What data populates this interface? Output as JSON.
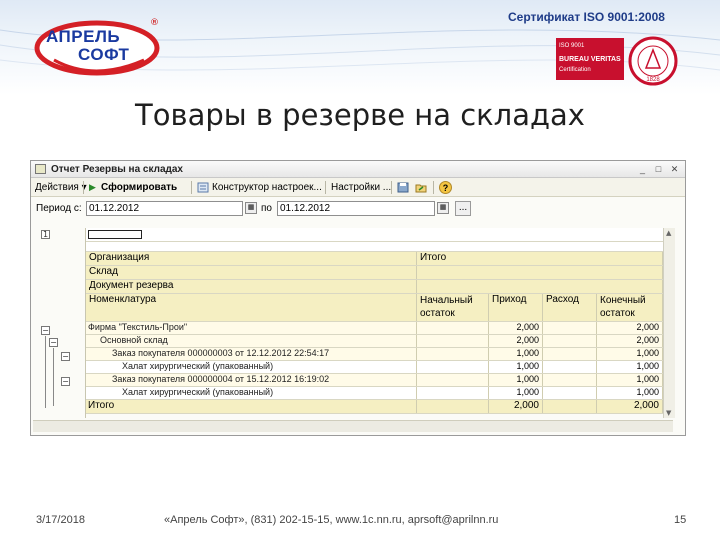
{
  "header": {
    "certificate": "Сертификат ISO 9001:2008",
    "logo_line1": "АПРЕЛЬ",
    "logo_line2": "СОФТ",
    "reg_mark": "®",
    "bv_iso": "ISO 9001",
    "bv_name": "BUREAU VERITAS",
    "bv_cert": "Certification",
    "seal_year": "1828"
  },
  "slide_title": "Товары в резерве на складах",
  "window": {
    "title": "Отчет Резервы на складах",
    "toolbar": {
      "actions": "Действия",
      "generate": "Сформировать",
      "constructor": "Конструктор настроек...",
      "settings": "Настройки ...",
      "help": "?"
    },
    "period": {
      "label": "Период с:",
      "from": "01.12.2012",
      "to_label": "по",
      "to": "01.12.2012",
      "more": "..."
    },
    "report": {
      "grouping_rows": [
        "Организация",
        "Склад",
        "Документ резерва"
      ],
      "total_header": "Итого",
      "nomenclature_header": "Номенклатура",
      "columns": [
        "Начальный остаток",
        "Приход",
        "Расход",
        "Конечный остаток"
      ],
      "rows": [
        {
          "label": "Фирма \"Текстиль-Прои\"",
          "start": "",
          "in": "2,000",
          "out": "",
          "end": "2,000"
        },
        {
          "label": "Основной склад",
          "start": "",
          "in": "2,000",
          "out": "",
          "end": "2,000"
        },
        {
          "label": "Заказ покупателя 000000003 от 12.12.2012 22:54:17",
          "start": "",
          "in": "1,000",
          "out": "",
          "end": "1,000"
        },
        {
          "label": "Халат хирургический (упакованный)",
          "start": "",
          "in": "1,000",
          "out": "",
          "end": "1,000"
        },
        {
          "label": "Заказ покупателя 000000004 от 15.12.2012 16:19:02",
          "start": "",
          "in": "1,000",
          "out": "",
          "end": "1,000"
        },
        {
          "label": "Халат хирургический (упакованный)",
          "start": "",
          "in": "1,000",
          "out": "",
          "end": "1,000"
        }
      ],
      "total_row": {
        "label": "Итого",
        "in": "2,000",
        "end": "2,000"
      }
    }
  },
  "footer": {
    "date": "3/17/2018",
    "contacts": "«Апрель Софт», (831) 202-15-15, www.1c.nn.ru, aprsoft@aprilnn.ru",
    "page": "15"
  },
  "colors": {
    "accent": "#1a3aa0",
    "logo_red": "#d42026",
    "bv_red": "#c8102e",
    "header_fill": "#f5efc2"
  }
}
